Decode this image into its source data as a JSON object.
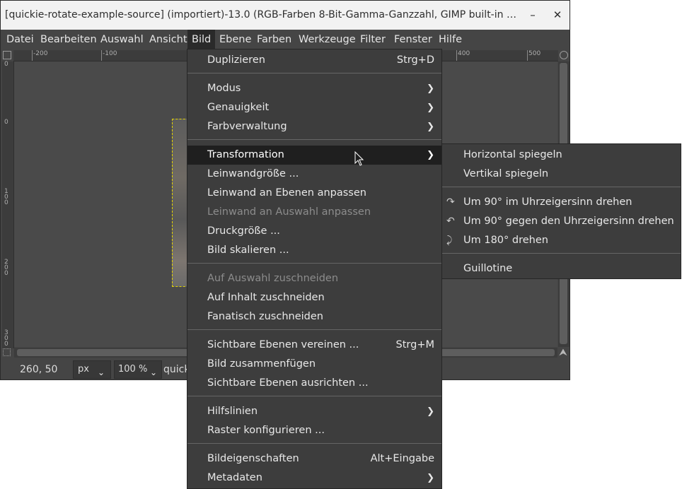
{
  "window": {
    "title": "[quickie-rotate-example-source] (importiert)-13.0 (RGB-Farben 8-Bit-Gamma-Ganzzahl, GIMP built-in sRG…",
    "minimize_label": "–",
    "close_label": "✕"
  },
  "menubar": [
    "Datei",
    "Bearbeiten",
    "Auswahl",
    "Ansicht",
    "Bild",
    "Ebene",
    "Farben",
    "Werkzeuge",
    "Filter",
    "Fenster",
    "Hilfe"
  ],
  "ruler_h": [
    "-200",
    "-100",
    "400",
    "500"
  ],
  "ruler_v": [
    "0",
    "0",
    "100",
    "200",
    "300"
  ],
  "status": {
    "coords": "260, 50",
    "unit": "px",
    "zoom": "100 %",
    "filename": "quick"
  },
  "bild_menu": {
    "g1": [
      {
        "label": "Duplizieren",
        "shortcut": "Strg+D"
      }
    ],
    "g2": [
      {
        "label": "Modus"
      },
      {
        "label": "Genauigkeit"
      },
      {
        "label": "Farbverwaltung"
      }
    ],
    "g3": [
      {
        "label": "Transformation"
      },
      {
        "label": "Leinwandgröße ..."
      },
      {
        "label": "Leinwand an Ebenen anpassen"
      },
      {
        "label": "Leinwand an Auswahl anpassen"
      },
      {
        "label": "Druckgröße ..."
      },
      {
        "label": "Bild skalieren ..."
      }
    ],
    "g4": [
      {
        "label": "Auf Auswahl zuschneiden"
      },
      {
        "label": "Auf Inhalt zuschneiden"
      },
      {
        "label": "Fanatisch zuschneiden"
      }
    ],
    "g5": [
      {
        "label": "Sichtbare Ebenen vereinen ...",
        "shortcut": "Strg+M"
      },
      {
        "label": "Bild zusammenfügen"
      },
      {
        "label": "Sichtbare Ebenen ausrichten ..."
      }
    ],
    "g6": [
      {
        "label": "Hilfslinien"
      },
      {
        "label": "Raster konfigurieren ..."
      }
    ],
    "g7": [
      {
        "label": "Bildeigenschaften",
        "shortcut": "Alt+Eingabe"
      },
      {
        "label": "Metadaten"
      }
    ]
  },
  "transform_menu": {
    "flip": [
      "Horizontal spiegeln",
      "Vertikal spiegeln"
    ],
    "rotate": [
      "Um 90° im Uhrzeigersinn drehen",
      "Um 90° gegen den Uhrzeigersinn drehen",
      "Um 180° drehen"
    ],
    "guillotine": "Guillotine"
  }
}
